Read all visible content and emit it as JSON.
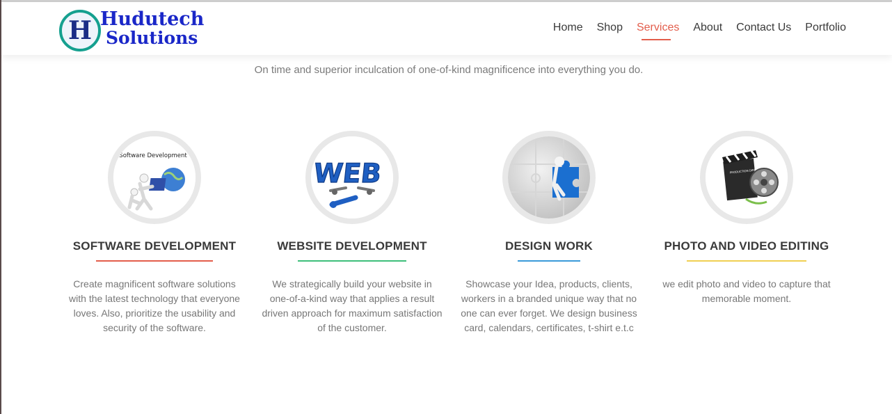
{
  "brand": {
    "logo_letter": "H",
    "name_line1": "Hudutech",
    "name_line2": "Solutions"
  },
  "nav": {
    "items": [
      {
        "label": "Home",
        "active": false
      },
      {
        "label": "Shop",
        "active": false
      },
      {
        "label": "Services",
        "active": true
      },
      {
        "label": "About",
        "active": false
      },
      {
        "label": "Contact Us",
        "active": false
      },
      {
        "label": "Portfolio",
        "active": false
      }
    ]
  },
  "tagline": "On time and superior inculcation of one-of-kind magnificence into everything you do.",
  "services": [
    {
      "title": "SOFTWARE DEVELOPMENT",
      "image_caption": "Software Development",
      "underline_color": "#e35d4b",
      "description": "Create magnificent software solutions with the latest technology that everyone loves. Also, prioritize the usability and security of the software."
    },
    {
      "title": "WEBSITE DEVELOPMENT",
      "image_caption": "WEB",
      "underline_color": "#3dbf7a",
      "description": "We strategically build your website in one-of-a-kind way that applies a result driven approach for maximum satisfaction of the customer."
    },
    {
      "title": "DESIGN WORK",
      "underline_color": "#3a9ad9",
      "description": "Showcase your Idea, products, clients, workers in a branded unique way that no one can ever forget. We design business card, calendars, certificates, t-shirt e.t.c"
    },
    {
      "title": "PHOTO AND VIDEO EDITING",
      "image_caption": "PRODUCTION DIRECTOR CAMERA DATE",
      "underline_color": "#f0cf52",
      "description": "we edit photo and video to capture that memorable moment."
    }
  ],
  "colors": {
    "accent": "#e35d4b",
    "logo_blue": "#1a27c8",
    "logo_teal": "#15a08f"
  }
}
